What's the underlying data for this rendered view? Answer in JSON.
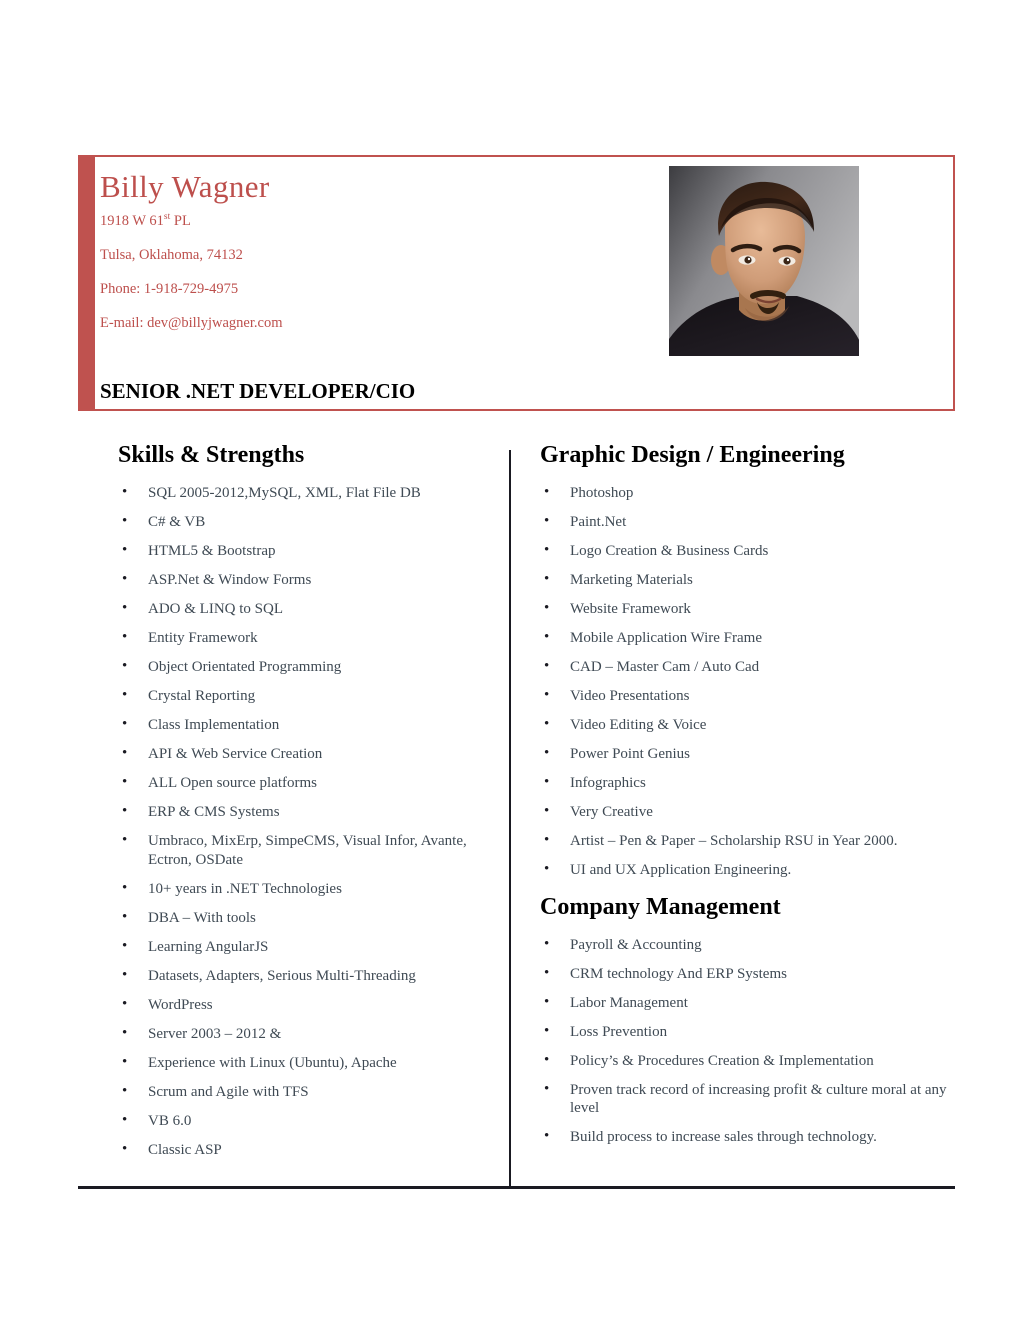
{
  "colors": {
    "accent_red": "#bf524f",
    "name_red": "#bd4f4c",
    "body_text": "#3f4a54",
    "rule_black": "#1a1a22"
  },
  "header": {
    "name": "Billy Wagner",
    "address_line_1_pre": "1918 W 61",
    "address_line_1_sup": "st",
    "address_line_1_post": " PL",
    "address_line_2": "Tulsa, Oklahoma, 74132",
    "phone": "Phone: 1-918-729-4975",
    "email": "E-mail: dev@billyjwagner.com",
    "job_title": "SENIOR .NET DEVELOPER/CIO",
    "photo_alt": "portrait-photo"
  },
  "left_column": {
    "heading": "Skills & Strengths",
    "items": [
      "SQL 2005-2012,MySQL, XML, Flat File DB",
      "C# & VB",
      "HTML5 & Bootstrap",
      "ASP.Net & Window Forms",
      "ADO & LINQ to SQL",
      "Entity Framework",
      "Object Orientated Programming",
      "Crystal Reporting",
      "Class Implementation",
      "API & Web Service Creation",
      "ALL Open source platforms",
      "ERP & CMS Systems",
      "Umbraco, MixErp, SimpeCMS, Visual Infor, Avante, Ectron, OSDate",
      "10+ years in .NET Technologies",
      "DBA – With tools",
      "Learning AngularJS",
      "Datasets, Adapters, Serious Multi-Threading",
      "WordPress",
      "Server 2003 – 2012 &",
      "Experience with Linux (Ubuntu), Apache",
      "Scrum and Agile with TFS",
      "VB 6.0",
      "Classic ASP"
    ]
  },
  "right_column": {
    "section_1": {
      "heading": "Graphic Design / Engineering",
      "items": [
        "Photoshop",
        "Paint.Net",
        "Logo Creation & Business Cards",
        "Marketing Materials",
        "Website Framework",
        "Mobile Application Wire Frame",
        "CAD – Master Cam / Auto Cad",
        "Video Presentations",
        "Video Editing & Voice",
        "Power Point Genius",
        "Infographics",
        "Very Creative",
        "Artist – Pen & Paper – Scholarship RSU in Year 2000.",
        "UI and UX Application Engineering."
      ]
    },
    "section_2": {
      "heading": "Company Management",
      "items": [
        "Payroll & Accounting",
        "CRM technology And ERP Systems",
        "Labor Management",
        "Loss Prevention",
        "Policy’s & Procedures Creation & Implementation",
        "Proven track record of increasing profit & culture moral at any level",
        "Build process to increase sales through technology."
      ]
    }
  }
}
